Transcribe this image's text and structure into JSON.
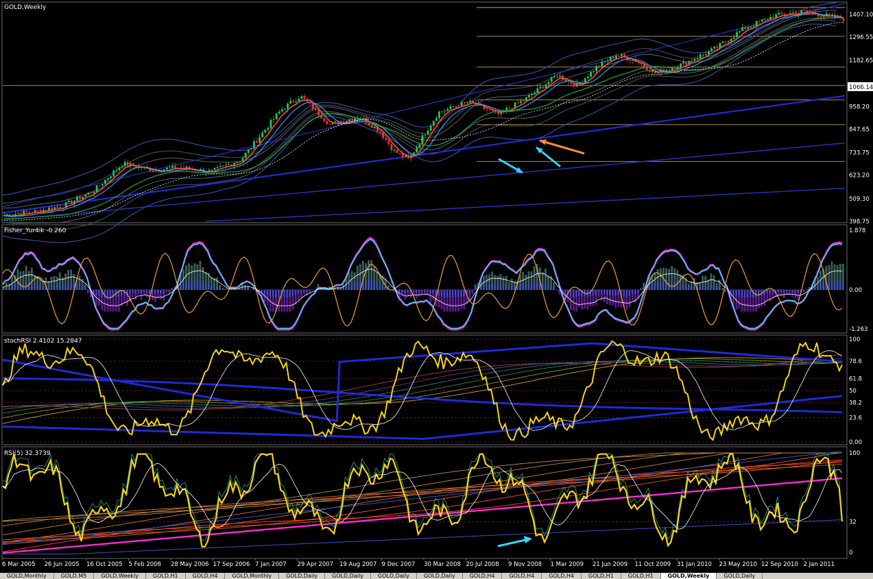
{
  "chart_data": [
    {
      "panel": "main",
      "type": "candlestick",
      "title": "GOLD,Weekly",
      "current_price_label": "1066.14",
      "y_ticks": [
        "1407.10",
        "1296.55",
        "1182.65",
        "958.20",
        "847.65",
        "733.75",
        "623.20",
        "509.30",
        "398.75"
      ],
      "ylim": [
        398.75,
        1460
      ],
      "series": [
        {
          "name": "price",
          "x": [
            0,
            6,
            12,
            18,
            24,
            30,
            36,
            42,
            48,
            52,
            56,
            60,
            66,
            72,
            76,
            79,
            82,
            85,
            88,
            94,
            100,
            106,
            112,
            116,
            120,
            124,
            128,
            132,
            138,
            144,
            150,
            156,
            162,
            170
          ],
          "values": [
            430,
            445,
            475,
            545,
            680,
            650,
            660,
            640,
            700,
            820,
            940,
            1010,
            870,
            910,
            840,
            740,
            700,
            820,
            930,
            980,
            920,
            1000,
            1110,
            1060,
            1150,
            1210,
            1180,
            1120,
            1170,
            1240,
            1340,
            1400,
            1420,
            1385
          ]
        }
      ],
      "fib_levels": [
        1440,
        1300,
        1150,
        1060,
        990,
        870,
        690
      ]
    },
    {
      "panel": "fisher",
      "type": "histogram+line",
      "title": "Fisher_Yur4ik -0.260",
      "y_ticks": [
        "1.878",
        "0.00",
        "-1.263"
      ],
      "ylim": [
        -1.263,
        1.878
      ]
    },
    {
      "panel": "stochrsi",
      "type": "line",
      "title": "stochRSI 2.4102 15.2847",
      "y_ticks": [
        "100",
        "78.6",
        "61.8",
        "50",
        "38.2",
        "23.6",
        "0.00"
      ],
      "ylim": [
        0,
        100
      ]
    },
    {
      "panel": "rsi",
      "type": "line",
      "title": "RSI(5) 32.3739",
      "y_ticks": [
        "100",
        "32",
        "0"
      ],
      "ylim": [
        0,
        100
      ]
    }
  ],
  "x_axis": {
    "labels": [
      "6 Mar 2005",
      "26 Jun 2005",
      "16 Oct 2005",
      "5 Feb 2006",
      "28 May 2006",
      "17 Sep 2006",
      "7 Jan 2007",
      "29 Apr 2007",
      "19 Aug 2007",
      "9 Dec 2007",
      "30 Mar 2008",
      "20 Jul 2008",
      "9 Nov 2008",
      "1 Mar 2009",
      "21 Jun 2009",
      "11 Oct 2009",
      "31 Jan 2010",
      "23 May 2010",
      "12 Sep 2010",
      "2 Jan 2011"
    ]
  },
  "tabs": [
    "GOLD,Monthly",
    "GOLD,M5",
    "GOLD,Weekly",
    "GOLD,H1",
    "GOLD,H4",
    "GOLD,Monthly",
    "GOLD,Daily",
    "GOLD,Daily",
    "GOLD,Daily",
    "GOLD,Daily",
    "GOLD,H4",
    "GOLD,H4",
    "GOLD,H4",
    "GOLD,H1",
    "GOLD,H1",
    "GOLD,Weekly",
    "GOLD,Daily"
  ],
  "active_tab": 15,
  "colors": {
    "background": "#000000",
    "bull": "#22c55e",
    "bear": "#e53935",
    "fib": "#c8a35a",
    "blue": "#1f2bd6",
    "yellow": "#f5d31a",
    "cyan": "#33d4ff",
    "magenta": "#ff2bd6",
    "orange": "#ff8a3a"
  }
}
